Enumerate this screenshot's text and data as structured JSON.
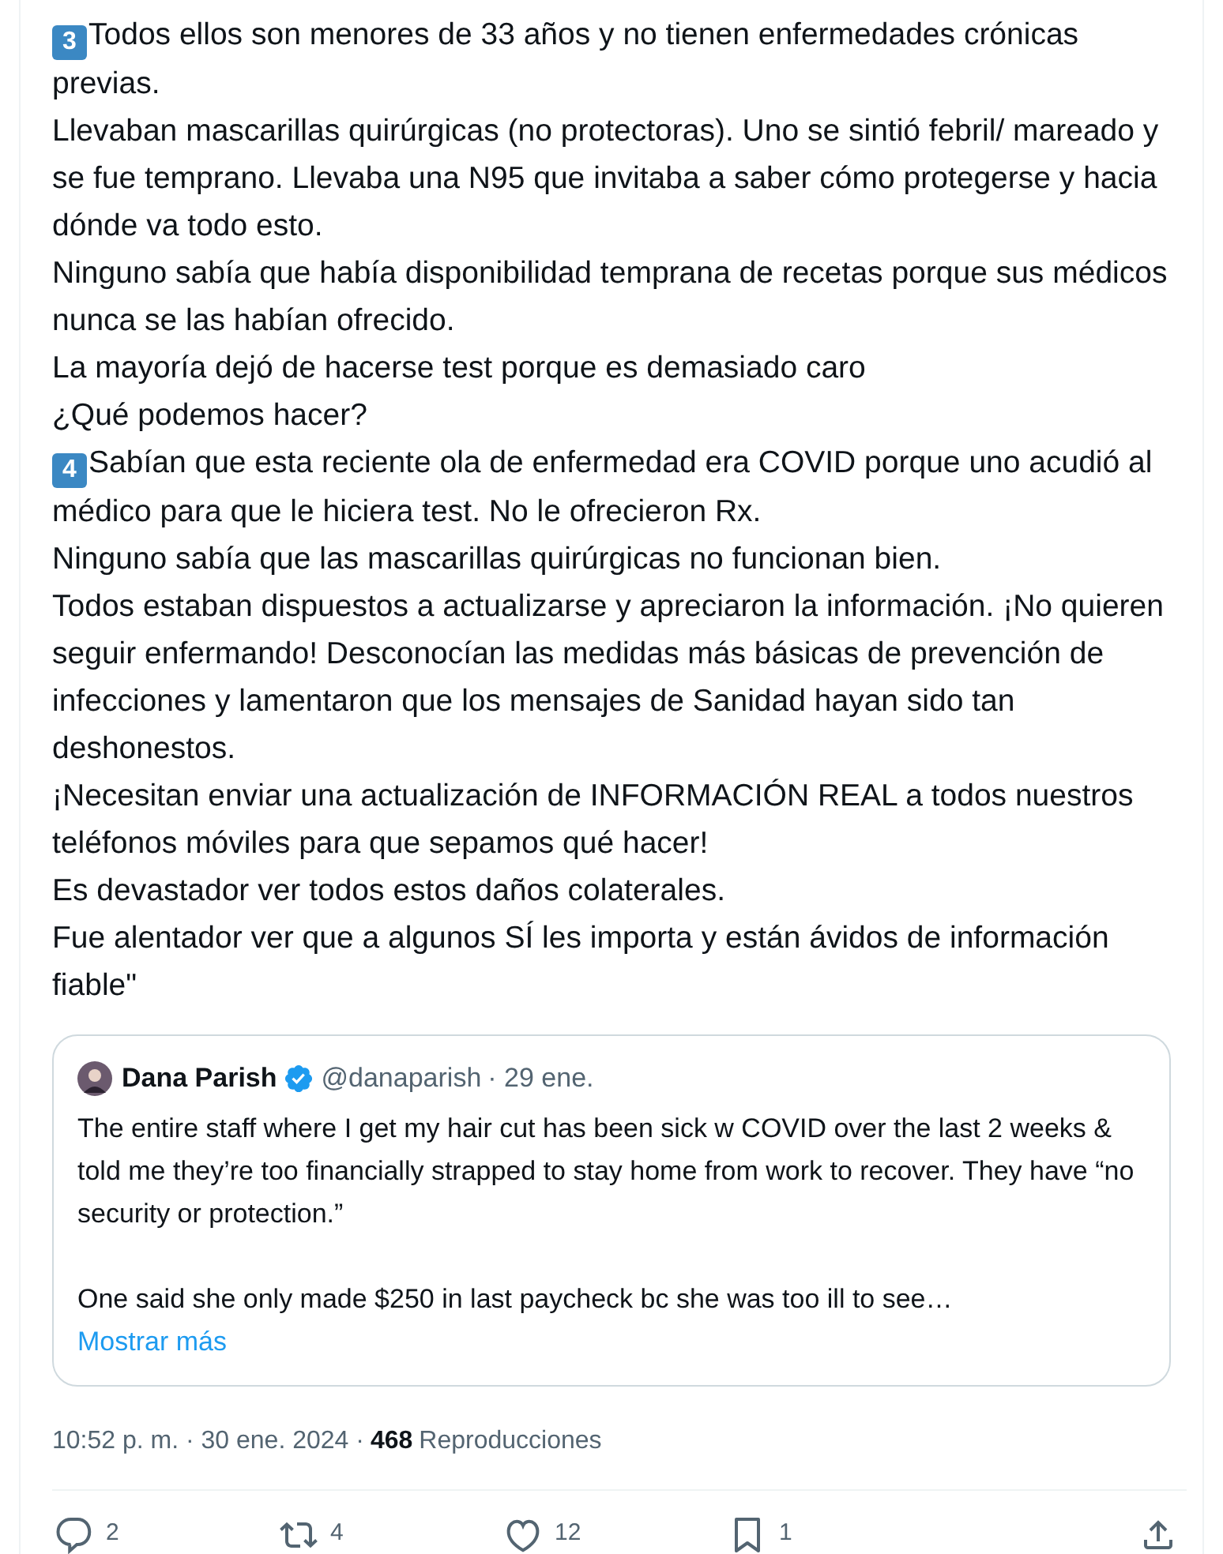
{
  "tweet": {
    "paragraphs": [
      {
        "badge": "3",
        "text": "Todos ellos son menores de 33 años y no tienen enfermedades crónicas previas."
      },
      {
        "text": "Llevaban mascarillas quirúrgicas (no protectoras). Uno se sintió febril/ mareado y se fue temprano. Llevaba una N95 que invitaba a saber cómo protegerse y hacia dónde va todo esto."
      },
      {
        "text": "Ninguno sabía que había disponibilidad temprana de recetas porque sus médicos nunca se las habían ofrecido."
      },
      {
        "text": "La mayoría dejó de hacerse test porque es demasiado caro"
      },
      {
        "text": "¿Qué podemos hacer?"
      },
      {
        "badge": "4",
        "text": "Sabían que esta reciente ola de enfermedad era COVID porque uno acudió al médico para que le hiciera test. No le ofrecieron Rx."
      },
      {
        "text": "Ninguno sabía que las mascarillas quirúrgicas no funcionan bien."
      },
      {
        "text": "Todos estaban dispuestos a actualizarse y apreciaron la información. ¡No quieren seguir enfermando! Desconocían las medidas más básicas de prevención de infecciones y lamentaron que los mensajes de Sanidad hayan sido tan deshonestos."
      },
      {
        "text": "¡Necesitan enviar una actualización de INFORMACIÓN REAL a todos nuestros teléfonos móviles para que sepamos qué hacer!"
      },
      {
        "text": "Es devastador ver todos estos daños colaterales."
      },
      {
        "text": "Fue alentador ver que a algunos SÍ les importa y están ávidos de información fiable\""
      }
    ],
    "quote": {
      "name": "Dana Parish",
      "verified": true,
      "handle": "@danaparish",
      "date": "· 29 ene.",
      "paragraphs": [
        "The entire staff where I get my hair cut has been sick w COVID over the last 2 weeks & told me they’re too financially strapped to stay home from work to recover. They have “no security or protection.”",
        "One said she only made $250 in last paycheck bc she was too ill to see…"
      ],
      "show_more": "Mostrar más"
    },
    "meta": {
      "time": "10:52 p. m. · 30 ene. 2024 ·",
      "views": "468",
      "views_label": "Reproducciones"
    },
    "actions": [
      {
        "kind": "reply",
        "count": "2"
      },
      {
        "kind": "repost",
        "count": "4"
      },
      {
        "kind": "like",
        "count": "12"
      },
      {
        "kind": "bookmark",
        "count": "1"
      },
      {
        "kind": "share"
      }
    ]
  }
}
